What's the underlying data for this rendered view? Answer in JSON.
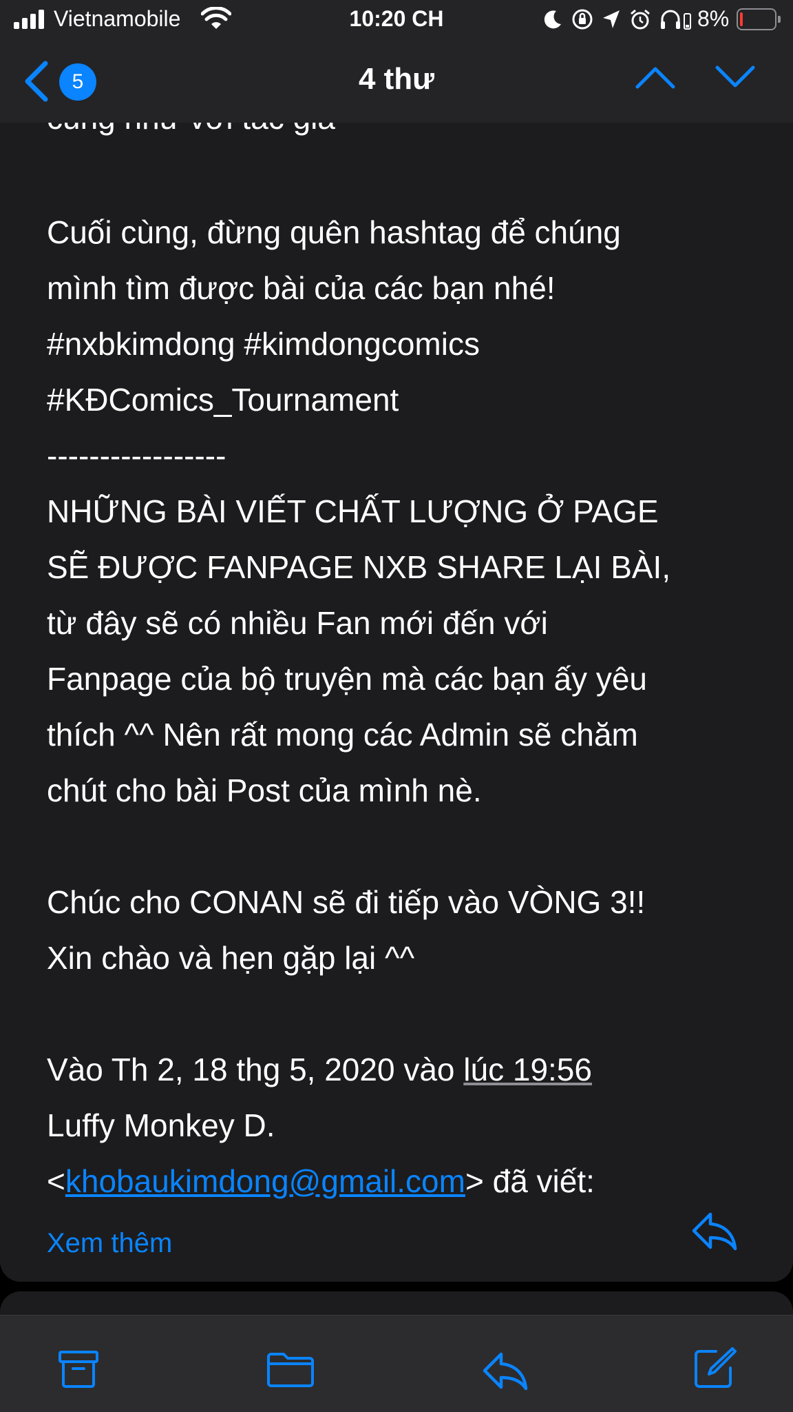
{
  "status_bar": {
    "carrier": "Vietnamobile",
    "time": "10:20 CH",
    "battery_percent": "8%",
    "battery_level": 0.08,
    "icons": [
      "signal-icon",
      "wifi-icon",
      "moon-icon",
      "orientation-lock-icon",
      "location-icon",
      "alarm-icon",
      "headphones-icon",
      "battery-icon"
    ]
  },
  "nav": {
    "back_badge": "5",
    "title": "4 thư"
  },
  "email": {
    "cut_line": "cũng như với tác giả",
    "paragraphs": {
      "p1_l1": "Cuối cùng, đừng quên hashtag để chúng",
      "p1_l2": "mình tìm được bài của các bạn nhé!",
      "p1_l3": "#nxbkimdong #kimdongcomics",
      "p1_l4": "#KĐComics_Tournament",
      "divider": "-----------------",
      "p2_l1": "NHỮNG BÀI VIẾT CHẤT LƯỢNG Ở PAGE",
      "p2_l2": "SẼ ĐƯỢC FANPAGE NXB SHARE LẠI BÀI,",
      "p2_l3": "từ đây sẽ có nhiều Fan mới đến với",
      "p2_l4": "Fanpage của bộ truyện mà các bạn ấy yêu",
      "p2_l5": "thích ^^ Nên rất mong các Admin sẽ chăm",
      "p2_l6": "chút cho bài Post của mình nè.",
      "p3_l1": "Chúc cho CONAN sẽ đi tiếp vào VÒNG 3!!",
      "p3_l2": "Xin chào và hẹn gặp lại ^^",
      "quote_prefix": "Vào Th 2, 18 thg 5, 2020 vào ",
      "quote_time": "lúc 19:56",
      "quote_name": "Luffy Monkey D.",
      "quote_open": "<",
      "quote_email": "khobaukimdong@gmail.com",
      "quote_close": "> đã viết:"
    },
    "see_more": "Xem thêm"
  },
  "toolbar": {
    "icons": [
      "archive-icon",
      "folder-icon",
      "reply-icon",
      "compose-icon"
    ]
  },
  "colors": {
    "accent": "#0a84ff",
    "background": "#1c1c1e",
    "bar": "#242426",
    "battery_low": "#ff3b30"
  }
}
